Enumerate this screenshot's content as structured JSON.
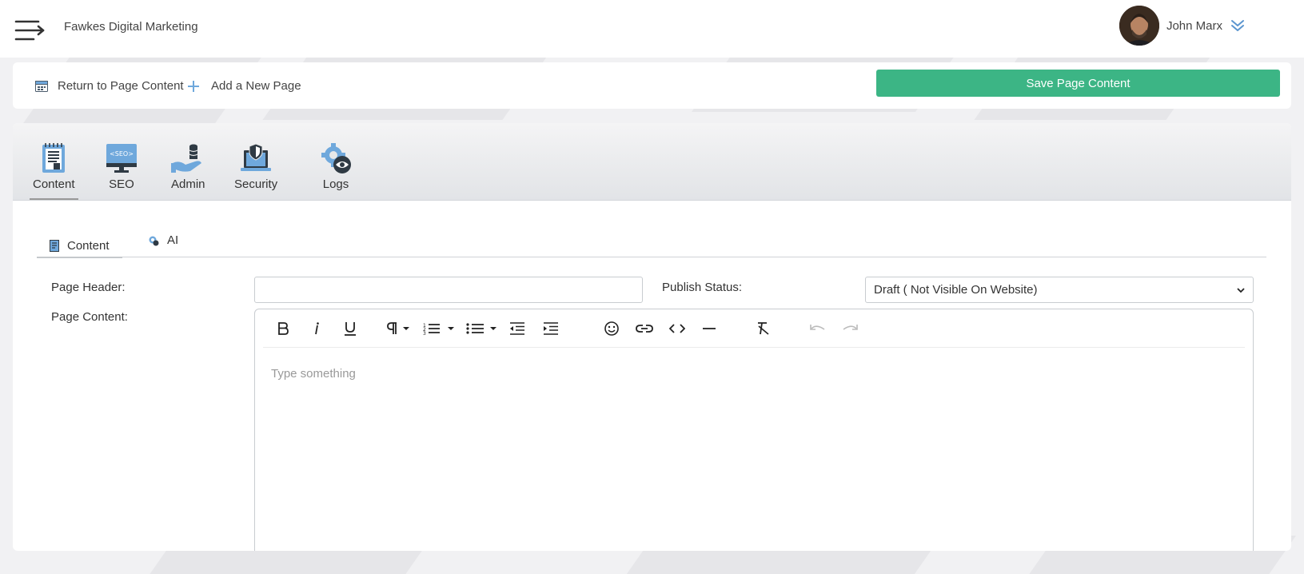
{
  "topbar": {
    "brand": "Fawkes Digital Marketing",
    "user_name": "John Marx"
  },
  "actions": {
    "return_label": "Return to Page Content",
    "add_label": "Add a New Page",
    "save_label": "Save Page Content"
  },
  "icon_tabs": [
    {
      "label": "Content",
      "icon": "content-icon",
      "active": true
    },
    {
      "label": "SEO",
      "icon": "seo-monitor-icon",
      "badge": "<SEO>"
    },
    {
      "label": "Admin",
      "icon": "admin-database-icon"
    },
    {
      "label": "Security",
      "icon": "security-laptop-icon"
    },
    {
      "label": "Logs",
      "icon": "logs-gear-eye-icon"
    }
  ],
  "sub_tabs": [
    {
      "label": "Content",
      "icon": "document-icon",
      "active": true
    },
    {
      "label": "AI",
      "icon": "ai-gear-icon"
    }
  ],
  "form": {
    "page_header_label": "Page Header:",
    "page_header_value": "",
    "publish_status_label": "Publish Status:",
    "publish_status_value": "Draft ( Not Visible On Website)",
    "page_content_label": "Page Content:",
    "editor_placeholder": "Type something"
  },
  "editor_toolbar": [
    "bold-icon",
    "italic-icon",
    "underline-icon",
    "paragraph-icon",
    "ordered-list-icon",
    "unordered-list-icon",
    "outdent-icon",
    "indent-icon",
    "emoji-icon",
    "link-icon",
    "code-icon",
    "horizontal-rule-icon",
    "clear-format-icon",
    "undo-icon",
    "redo-icon"
  ],
  "colors": {
    "accent": "#3cb585",
    "icon_blue": "#6fa8dc",
    "dark": "#2f3a44"
  }
}
